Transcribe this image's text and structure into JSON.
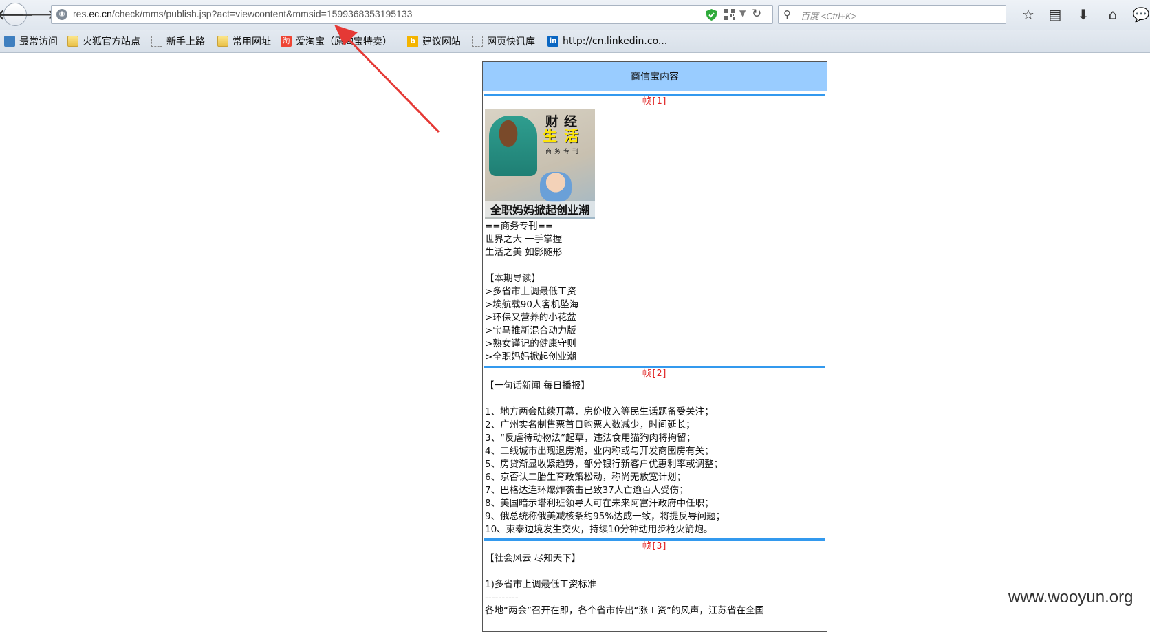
{
  "browser": {
    "url_prefix": "res.",
    "url_host": "ec.cn",
    "url_path": "/check/mms/publish.jsp?act=viewcontent&mmsid=1599368353195133",
    "search_placeholder": "百度 <Ctrl+K>"
  },
  "bookmarks": [
    {
      "label": "最常访问"
    },
    {
      "label": "火狐官方站点"
    },
    {
      "label": "新手上路"
    },
    {
      "label": "常用网址"
    },
    {
      "label": "爱淘宝（原淘宝特卖）"
    },
    {
      "label": "建议网站"
    },
    {
      "label": "网页快讯库"
    },
    {
      "label": "http://cn.linkedin.co..."
    }
  ],
  "mms": {
    "header": "商信宝内容",
    "frames": [
      {
        "title": "帧[1]",
        "image_caption": "全职妈妈掀起创业潮",
        "image_tag_top": "财经",
        "image_tag_main": "生活",
        "image_tag_sub": "商务专刊",
        "text": "==商务专刊==\n世界之大 一手掌握\n生活之美 如影随形\n\n【本期导读】\n>多省市上调最低工资\n>埃航载90人客机坠海\n>环保又营养的小花盆\n>宝马推新混合动力版\n>熟女谨记的健康守则\n>全职妈妈掀起创业潮"
      },
      {
        "title": "帧[2]",
        "text": "【一句话新闻 每日播报】\n\n1、地方两会陆续开幕，房价收入等民生话题备受关注；\n2、广州实名制售票首日购票人数减少，时间延长；\n3、“反虐待动物法”起草，违法食用猫狗肉将拘留；\n4、二线城市出现退房潮，业内称或与开发商囤房有关；\n5、房贷渐显收紧趋势，部分银行新客户优惠利率或调整；\n6、京否认二胎生育政策松动，称尚无放宽计划；\n7、巴格达连环爆炸袭击已致37人亡逾百人受伤；\n8、美国暗示塔利班领导人可在未来阿富汗政府中任职；\n9、俄总统称俄美减核条约95%达成一致，将提反导问题；\n10、柬泰边境发生交火，持续10分钟动用步枪火箭炮。"
      },
      {
        "title": "帧[3]",
        "text": "【社会风云 尽知天下】\n\n1)多省市上调最低工资标准\n----------\n各地“两会”召开在即，各个省市传出“涨工资”的风声，江苏省在全国"
      }
    ]
  },
  "watermark": "www.wooyun.org",
  "colors": {
    "header_bg": "#99ccff",
    "frame_bar": "#3399ee",
    "frame_title": "#e02020",
    "arrow": "#e53935"
  }
}
